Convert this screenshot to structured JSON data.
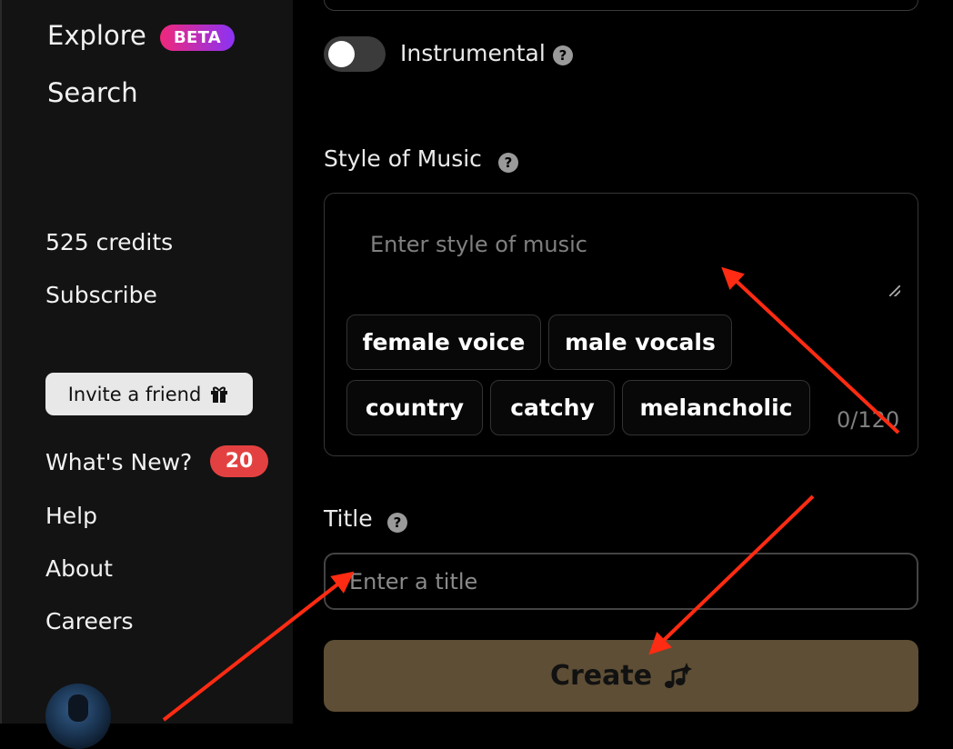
{
  "sidebar": {
    "explore_label": "Explore",
    "beta_badge": "BETA",
    "search_label": "Search",
    "credits": "525 credits",
    "subscribe_label": "Subscribe",
    "invite_label": "Invite a friend",
    "whats_new_label": "What's New?",
    "whats_new_count": "20",
    "help_label": "Help",
    "about_label": "About",
    "careers_label": "Careers"
  },
  "form": {
    "instrumental_label": "Instrumental",
    "style_label": "Style of Music",
    "style_placeholder": "Enter style of music",
    "style_counter": "0/120",
    "style_chips": [
      "female voice",
      "male vocals",
      "country",
      "catchy",
      "melancholic"
    ],
    "title_label": "Title",
    "title_placeholder": "Enter a title",
    "create_label": "Create"
  },
  "colors": {
    "accent_badge": "#e34141",
    "beta_gradient_start": "#f0287a",
    "beta_gradient_end": "#8a33f5",
    "create_button": "#5e4e35",
    "annotation_arrow": "#ff2b12"
  },
  "icons": [
    "help-icon",
    "gift-icon",
    "music-sparkle-icon"
  ]
}
